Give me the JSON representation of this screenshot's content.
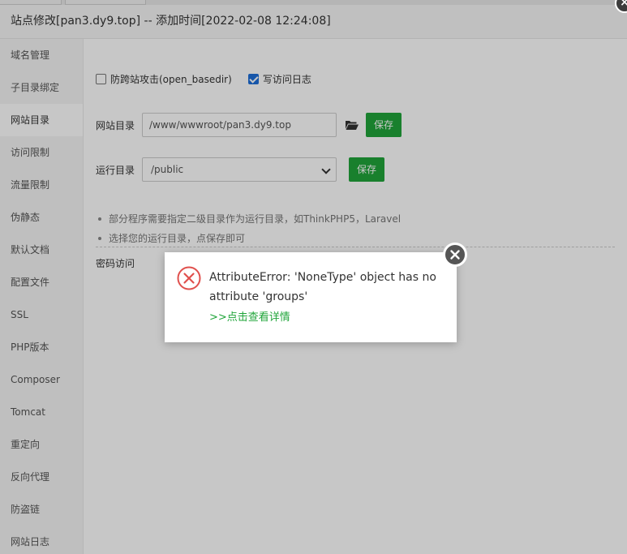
{
  "window": {
    "title": "站点修改[pan3.dy9.top] -- 添加时间[2022-02-08 12:24:08]"
  },
  "sidebar": {
    "items": [
      {
        "label": "域名管理"
      },
      {
        "label": "子目录绑定"
      },
      {
        "label": "网站目录",
        "active": true
      },
      {
        "label": "访问限制"
      },
      {
        "label": "流量限制"
      },
      {
        "label": "伪静态"
      },
      {
        "label": "默认文档"
      },
      {
        "label": "配置文件"
      },
      {
        "label": "SSL"
      },
      {
        "label": "PHP版本"
      },
      {
        "label": "Composer"
      },
      {
        "label": "Tomcat"
      },
      {
        "label": "重定向"
      },
      {
        "label": "反向代理"
      },
      {
        "label": "防盗链"
      },
      {
        "label": "网站日志"
      }
    ]
  },
  "options": {
    "anti_xss_label": "防跨站攻击(open_basedir)",
    "anti_xss_checked": false,
    "access_log_label": "写访问日志",
    "access_log_checked": true
  },
  "site_dir": {
    "label": "网站目录",
    "value": "/www/wwwroot/pan3.dy9.top",
    "folder_icon": "folder-open-icon",
    "save_label": "保存"
  },
  "run_dir": {
    "label": "运行目录",
    "selected": "/public",
    "save_label": "保存"
  },
  "tips": [
    "部分程序需要指定二级目录作为运行目录，如ThinkPHP5，Laravel",
    "选择您的运行目录，点保存即可"
  ],
  "password_access": {
    "label": "密码访问"
  },
  "error_dialog": {
    "message": "AttributeError: 'NoneType' object has no attribute 'groups'",
    "link": ">>点击查看详情",
    "icon": "error-circle-icon"
  },
  "colors": {
    "accent_green": "#20a53a",
    "error_red": "#e0504d",
    "checkbox_blue": "#1e6fd9"
  }
}
